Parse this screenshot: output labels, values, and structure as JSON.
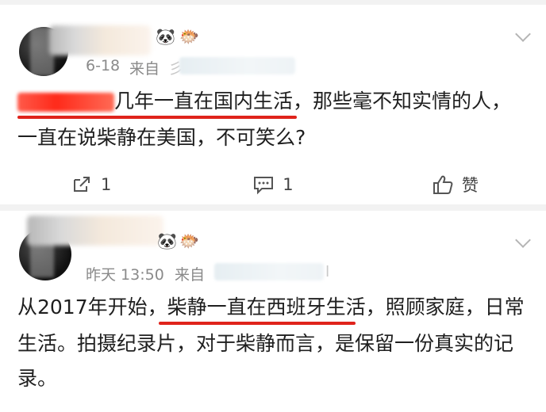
{
  "posts": [
    {
      "meta_date": "6-18",
      "meta_from": "来自",
      "source_fragment": "彡",
      "line1": "几年一直在国内生活，那些毫不知实情的人，",
      "line2": "一直在说柴静在美国，不可笑么?",
      "actions": {
        "repost_count": "1",
        "comment_count": "1",
        "like_label": "赞"
      },
      "emojis": [
        "🐼",
        "🐡"
      ]
    },
    {
      "meta_date": "昨天 13:50",
      "meta_from": "来自",
      "source_fragment": "l",
      "line1_a": "从2017年开始，",
      "line1_b": "柴静一直在西班牙生活",
      "line1_c": "，照顾家庭，日常",
      "line2": "生活。拍摄纪录片，对于柴静而言，是保留一份真实的记",
      "line3": "录。",
      "emojis": [
        "🐼",
        "🐡"
      ]
    }
  ],
  "colors": {
    "accent_red": "#e0231b",
    "meta_gray": "#8a8a8a",
    "separator": "#f2f2f2"
  }
}
